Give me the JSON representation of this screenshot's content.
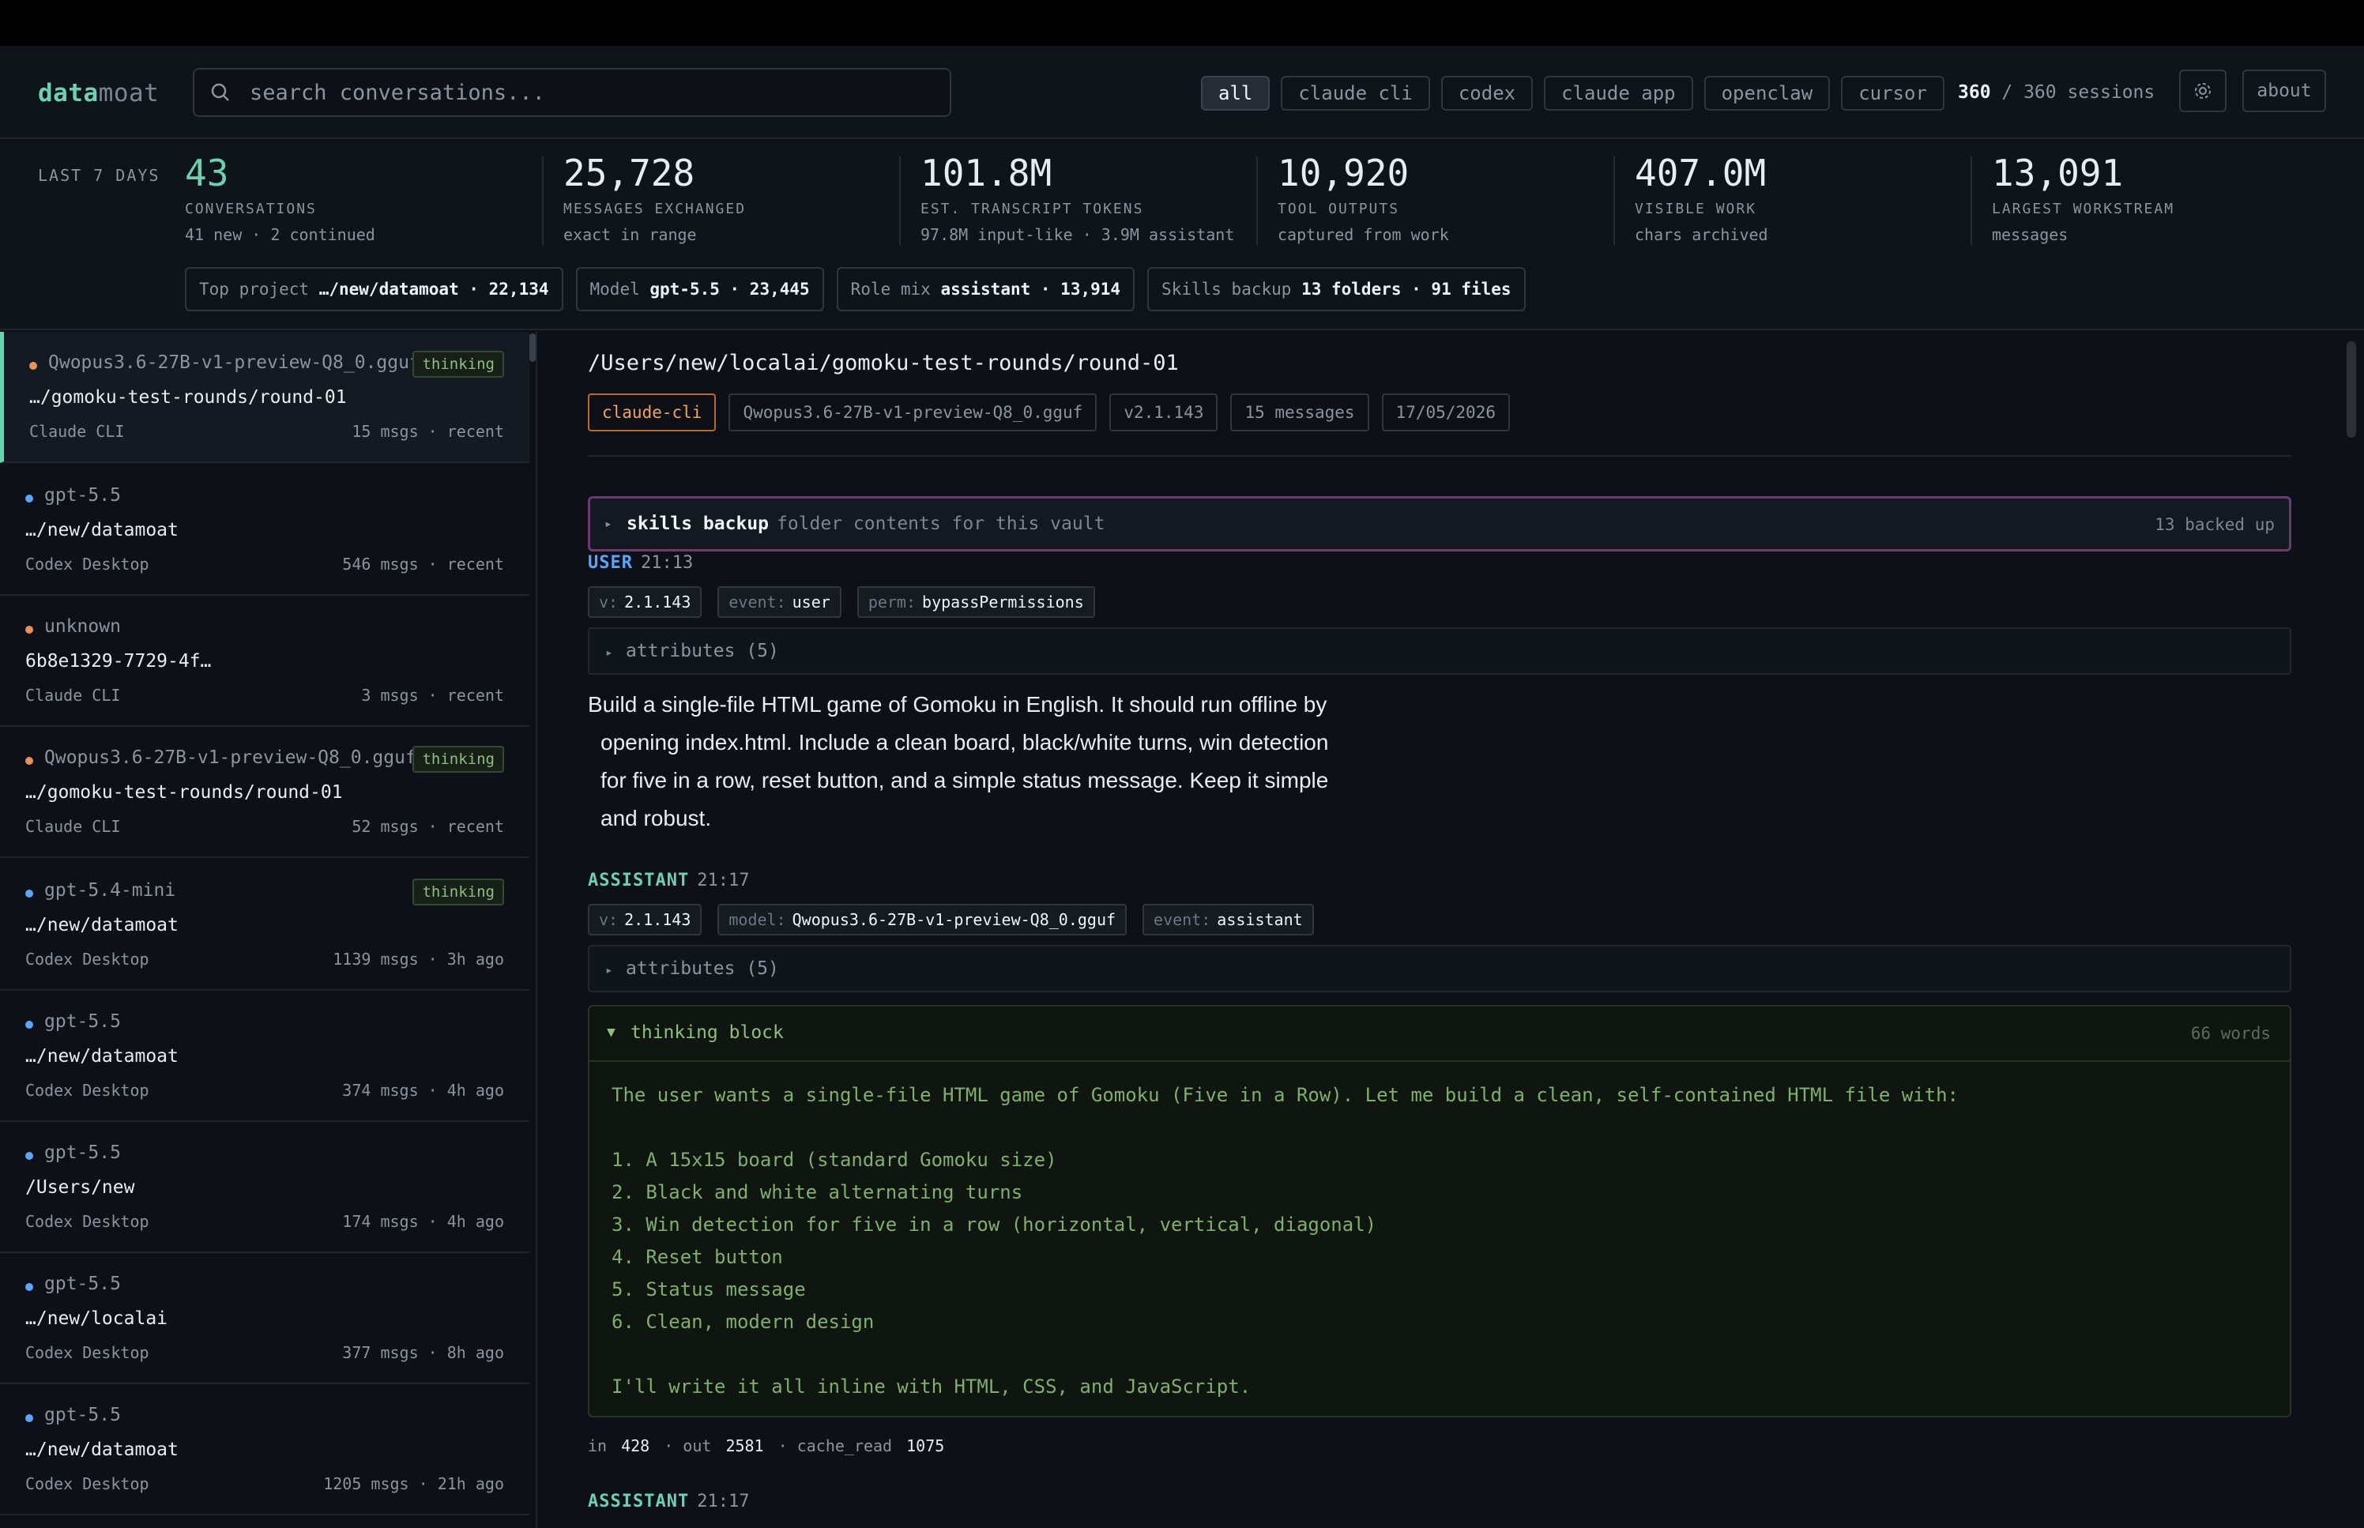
{
  "app": {
    "logo_a": "data",
    "logo_b": "moat"
  },
  "search": {
    "placeholder": "search conversations..."
  },
  "filters": [
    "all",
    "claude cli",
    "codex",
    "claude app",
    "openclaw",
    "cursor"
  ],
  "sessions": {
    "shown": "360",
    "rest": " / 360 sessions"
  },
  "header_buttons": {
    "about": "about",
    "settings_icon": "gear-icon"
  },
  "stats": {
    "range": "LAST 7 DAYS",
    "items": [
      {
        "value": "43",
        "label": "CONVERSATIONS",
        "sub": "41 new · 2 continued"
      },
      {
        "value": "25,728",
        "label": "MESSAGES EXCHANGED",
        "sub": "exact in range"
      },
      {
        "value": "101.8M",
        "label": "EST. TRANSCRIPT TOKENS",
        "sub": "97.8M input-like · 3.9M assistant"
      },
      {
        "value": "10,920",
        "label": "TOOL OUTPUTS",
        "sub": "captured from work"
      },
      {
        "value": "407.0M",
        "label": "VISIBLE WORK",
        "sub": "chars archived"
      },
      {
        "value": "13,091",
        "label": "LARGEST WORKSTREAM",
        "sub": "messages"
      }
    ],
    "pills": [
      {
        "k": "Top project ",
        "v": "…/new/datamoat · 22,134"
      },
      {
        "k": "Model ",
        "v": "gpt-5.5 · 23,445"
      },
      {
        "k": "Role mix ",
        "v": "assistant · 13,914"
      },
      {
        "k": "Skills backup ",
        "v": "13 folders · 91 files"
      }
    ]
  },
  "colors": {
    "accent": "#6cd1b1",
    "dot_orange": "#e8915a",
    "dot_blue": "#58a6ff"
  },
  "sidebar": {
    "items": [
      {
        "model": "Qwopus3.6-27B-v1-preview-Q8_0.gguf",
        "tag": "thinking",
        "path": "…/gomoku-test-rounds/round-01",
        "source": "Claude CLI",
        "meta": "15 msgs · recent",
        "dot": "orange"
      },
      {
        "model": "gpt-5.5",
        "tag": "",
        "path": "…/new/datamoat",
        "source": "Codex Desktop",
        "meta": "546 msgs · recent",
        "dot": "blue"
      },
      {
        "model": "unknown",
        "tag": "",
        "path": "6b8e1329-7729-4f…",
        "source": "Claude CLI",
        "meta": "3 msgs · recent",
        "dot": "orange"
      },
      {
        "model": "Qwopus3.6-27B-v1-preview-Q8_0.gguf",
        "tag": "thinking",
        "path": "…/gomoku-test-rounds/round-01",
        "source": "Claude CLI",
        "meta": "52 msgs · recent",
        "dot": "orange"
      },
      {
        "model": "gpt-5.4-mini",
        "tag": "thinking",
        "path": "…/new/datamoat",
        "source": "Codex Desktop",
        "meta": "1139 msgs · 3h ago",
        "dot": "blue"
      },
      {
        "model": "gpt-5.5",
        "tag": "",
        "path": "…/new/datamoat",
        "source": "Codex Desktop",
        "meta": "374 msgs · 4h ago",
        "dot": "blue"
      },
      {
        "model": "gpt-5.5",
        "tag": "",
        "path": "/Users/new",
        "source": "Codex Desktop",
        "meta": "174 msgs · 4h ago",
        "dot": "blue"
      },
      {
        "model": "gpt-5.5",
        "tag": "",
        "path": "…/new/localai",
        "source": "Codex Desktop",
        "meta": "377 msgs · 8h ago",
        "dot": "blue"
      },
      {
        "model": "gpt-5.5",
        "tag": "",
        "path": "…/new/datamoat",
        "source": "Codex Desktop",
        "meta": "1205 msgs · 21h ago",
        "dot": "blue"
      }
    ]
  },
  "conversation": {
    "title": "/Users/new/localai/gomoku-test-rounds/round-01",
    "badges": [
      "claude-cli",
      "Qwopus3.6-27B-v1-preview-Q8_0.gguf",
      "v2.1.143",
      "15 messages",
      "17/05/2026"
    ],
    "skills": {
      "title": "skills backup",
      "desc": "folder contents for this vault",
      "count": "13 backed up"
    },
    "user": {
      "role": "USER",
      "time": "21:13",
      "kv": [
        {
          "k": "v:",
          "v": "2.1.143"
        },
        {
          "k": "event:",
          "v": "user"
        },
        {
          "k": "perm:",
          "v": "bypassPermissions"
        }
      ],
      "attributes": "attributes (5)",
      "lines": [
        "Build a single-file HTML game of Gomoku in English. It should run offline by",
        "opening index.html. Include a clean board, black/white turns, win detection",
        "for five in a row, reset button, and a simple status message. Keep it simple",
        "and robust."
      ]
    },
    "assistant": {
      "role": "ASSISTANT",
      "time": "21:17",
      "kv": [
        {
          "k": "v:",
          "v": "2.1.143"
        },
        {
          "k": "model:",
          "v": "Qwopus3.6-27B-v1-preview-Q8_0.gguf"
        },
        {
          "k": "event:",
          "v": "assistant"
        }
      ],
      "attributes": "attributes (5)",
      "thinking": {
        "title": "thinking block",
        "words": "66 words",
        "text": "The user wants a single-file HTML game of Gomoku (Five in a Row). Let me build a clean, self-contained HTML file with:\n\n1. A 15x15 board (standard Gomoku size)\n2. Black and white alternating turns\n3. Win detection for five in a row (horizontal, vertical, diagonal)\n4. Reset button\n5. Status message\n6. Clean, modern design\n\nI'll write it all inline with HTML, CSS, and JavaScript."
      },
      "usage": {
        "in_label": "in",
        "in": "428",
        "out_label": "· out",
        "out": "2581",
        "cache_label": "· cache_read",
        "cache": "1075"
      }
    },
    "assistant2": {
      "role": "ASSISTANT",
      "time": "21:17"
    }
  }
}
